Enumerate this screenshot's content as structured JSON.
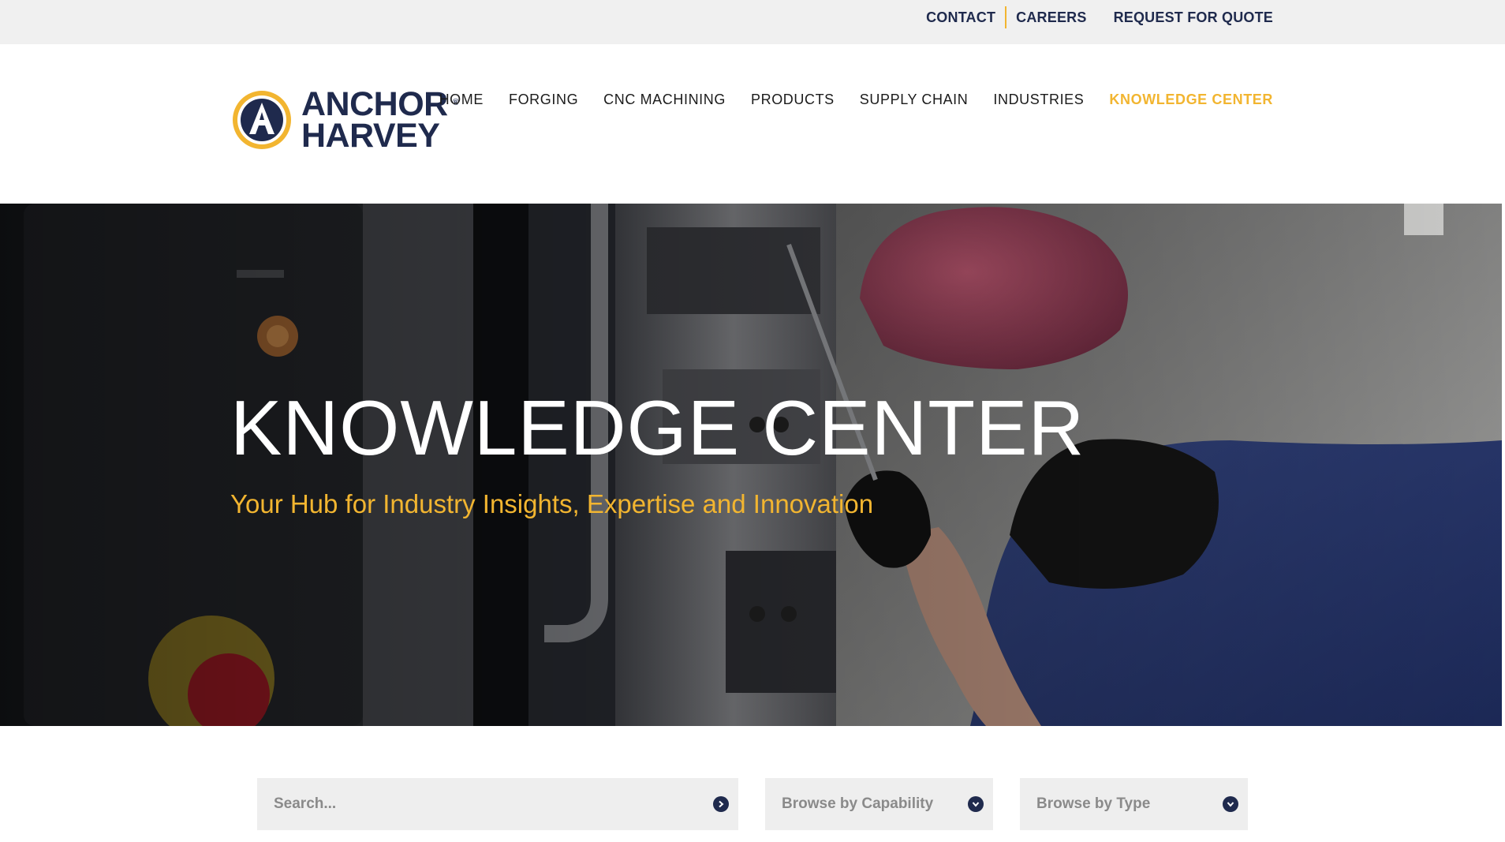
{
  "topbar": {
    "contact": "CONTACT",
    "careers": "CAREERS",
    "quote": "REQUEST FOR QUOTE"
  },
  "brand": {
    "line1": "ANCHOR",
    "line2": "HARVEY",
    "registered": "®",
    "color_navy": "#1f2a4d",
    "color_gold": "#f2b530"
  },
  "nav": {
    "items": [
      {
        "label": "HOME"
      },
      {
        "label": "FORGING"
      },
      {
        "label": "CNC MACHINING"
      },
      {
        "label": "PRODUCTS"
      },
      {
        "label": "SUPPLY CHAIN"
      },
      {
        "label": "INDUSTRIES"
      },
      {
        "label": "KNOWLEDGE CENTER",
        "active": true
      }
    ]
  },
  "hero": {
    "title": "KNOWLEDGE CENTER",
    "subtitle": "Your Hub for Industry Insights, Expertise and Innovation"
  },
  "filters": {
    "search_placeholder": "Search...",
    "search_icon": "arrow-right-circle-icon",
    "capability_label": "Browse by Capability",
    "type_label": "Browse by Type",
    "dropdown_icon": "chevron-down-circle-icon"
  }
}
